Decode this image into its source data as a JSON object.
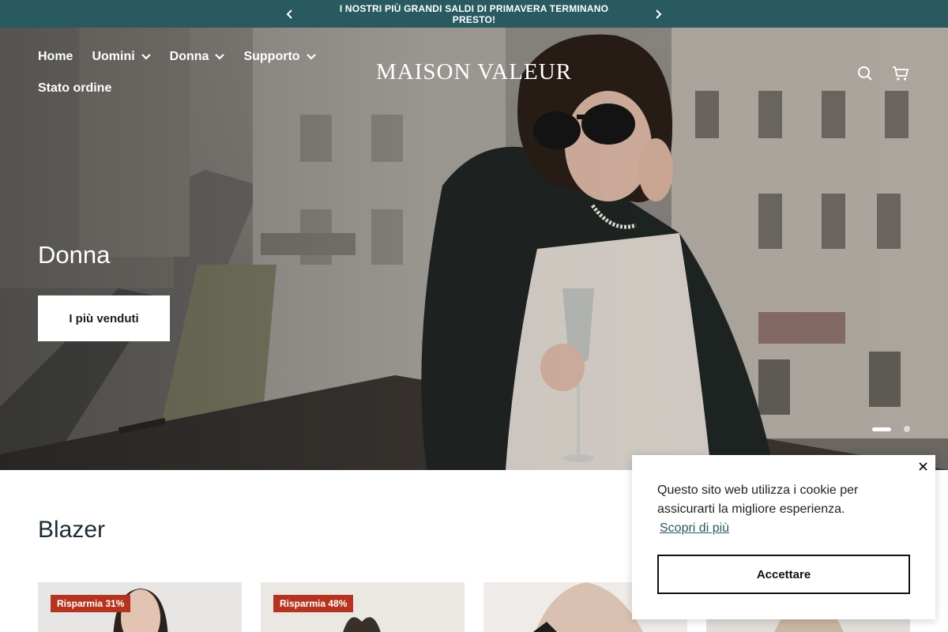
{
  "announcement": {
    "text": "I NOSTRI PIÙ GRANDI SALDI DI PRIMAVERA TERMINANO PRESTO!",
    "prev_icon": "chevron-left-icon",
    "next_icon": "chevron-right-icon"
  },
  "nav": {
    "items": [
      {
        "label": "Home",
        "dropdown": false
      },
      {
        "label": "Uomini",
        "dropdown": true
      },
      {
        "label": "Donna",
        "dropdown": true
      },
      {
        "label": "Supporto",
        "dropdown": true
      },
      {
        "label": "Stato ordine",
        "dropdown": false
      }
    ]
  },
  "brand": {
    "logo_text": "MAISON VALEUR"
  },
  "header_icons": [
    "search-icon",
    "cart-icon"
  ],
  "hero": {
    "title": "Donna",
    "button_label": "I più venduti",
    "slides_total": 2,
    "active_slide": 1
  },
  "section": {
    "title": "Blazer"
  },
  "products": [
    {
      "badge": "Risparmia 31%"
    },
    {
      "badge": "Risparmia 48%"
    },
    {
      "badge": ""
    },
    {
      "badge": ""
    }
  ],
  "cookie": {
    "message": "Questo sito web utilizza i cookie per assicurarti la migliore esperienza.",
    "learn_more": "Scopri di più",
    "accept_label": "Accettare"
  },
  "colors": {
    "announcement_bg": "#285a60",
    "badge_bg": "#b5331f",
    "heading_text": "#1c2c34"
  }
}
